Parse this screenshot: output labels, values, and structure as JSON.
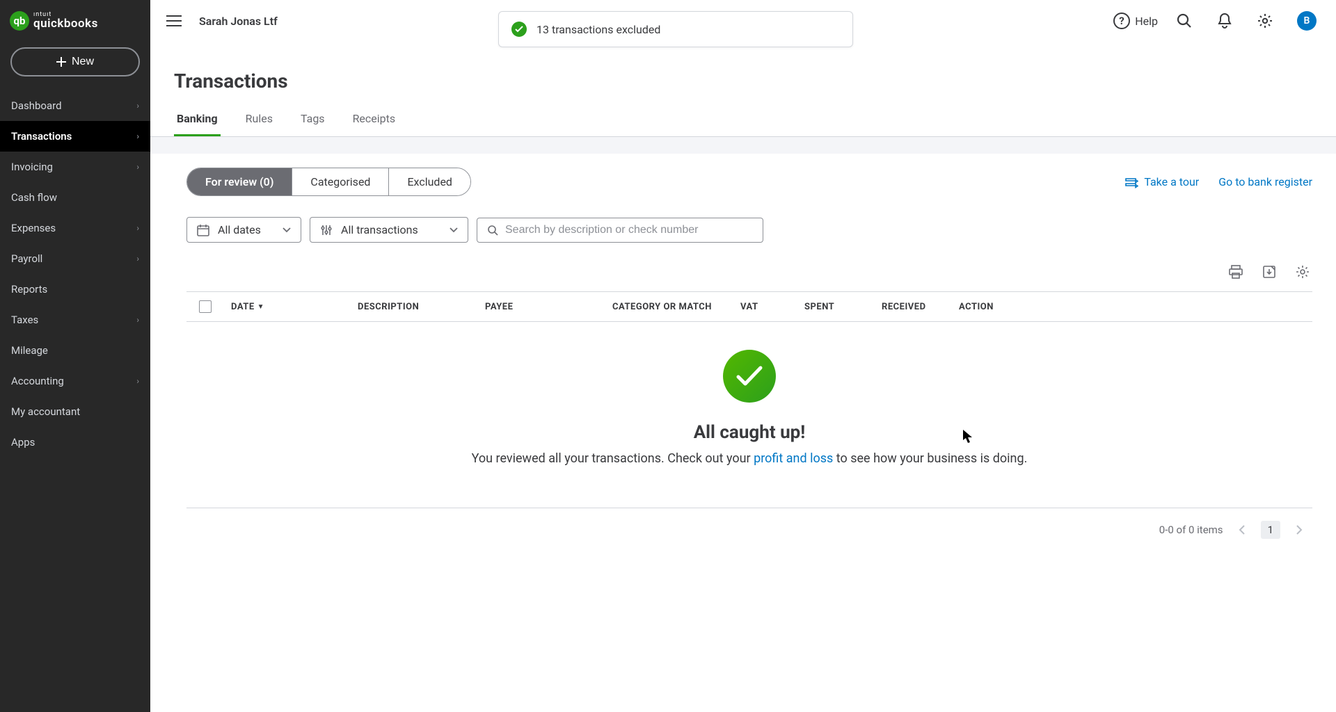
{
  "brand": {
    "intuit": "ıntuıt",
    "name": "quickbooks",
    "badge_letter": "qb"
  },
  "sidebar": {
    "new_label": "New",
    "items": [
      {
        "label": "Dashboard",
        "chevron": true
      },
      {
        "label": "Transactions",
        "chevron": true,
        "active": true
      },
      {
        "label": "Invoicing",
        "chevron": true
      },
      {
        "label": "Cash flow",
        "chevron": false
      },
      {
        "label": "Expenses",
        "chevron": true
      },
      {
        "label": "Payroll",
        "chevron": true
      },
      {
        "label": "Reports",
        "chevron": false
      },
      {
        "label": "Taxes",
        "chevron": true
      },
      {
        "label": "Mileage",
        "chevron": false
      },
      {
        "label": "Accounting",
        "chevron": true
      },
      {
        "label": "My accountant",
        "chevron": false
      },
      {
        "label": "Apps",
        "chevron": false
      }
    ]
  },
  "topbar": {
    "company": "Sarah Jonas Ltf",
    "help": "Help",
    "avatar_letter": "B"
  },
  "toast": {
    "message": "13 transactions excluded"
  },
  "page": {
    "title": "Transactions"
  },
  "tabs": [
    {
      "label": "Banking",
      "active": true
    },
    {
      "label": "Rules"
    },
    {
      "label": "Tags"
    },
    {
      "label": "Receipts"
    }
  ],
  "filters": {
    "pills": [
      {
        "label": "For review (0)",
        "active": true
      },
      {
        "label": "Categorised"
      },
      {
        "label": "Excluded"
      }
    ],
    "tour": "Take a tour",
    "register": "Go to bank register",
    "date_label": "All dates",
    "type_label": "All transactions",
    "search_placeholder": "Search by description or check number"
  },
  "table": {
    "headers": {
      "date": "DATE",
      "description": "DESCRIPTION",
      "payee": "PAYEE",
      "category": "CATEGORY OR MATCH",
      "vat": "VAT",
      "spent": "SPENT",
      "received": "RECEIVED",
      "action": "ACTION"
    },
    "empty": {
      "title": "All caught up!",
      "subtitle_pre": "You reviewed all your transactions. Check out your ",
      "link": "profit and loss",
      "subtitle_post": " to see how your business is doing."
    }
  },
  "pager": {
    "summary": "0-0 of 0 items",
    "page": "1"
  }
}
